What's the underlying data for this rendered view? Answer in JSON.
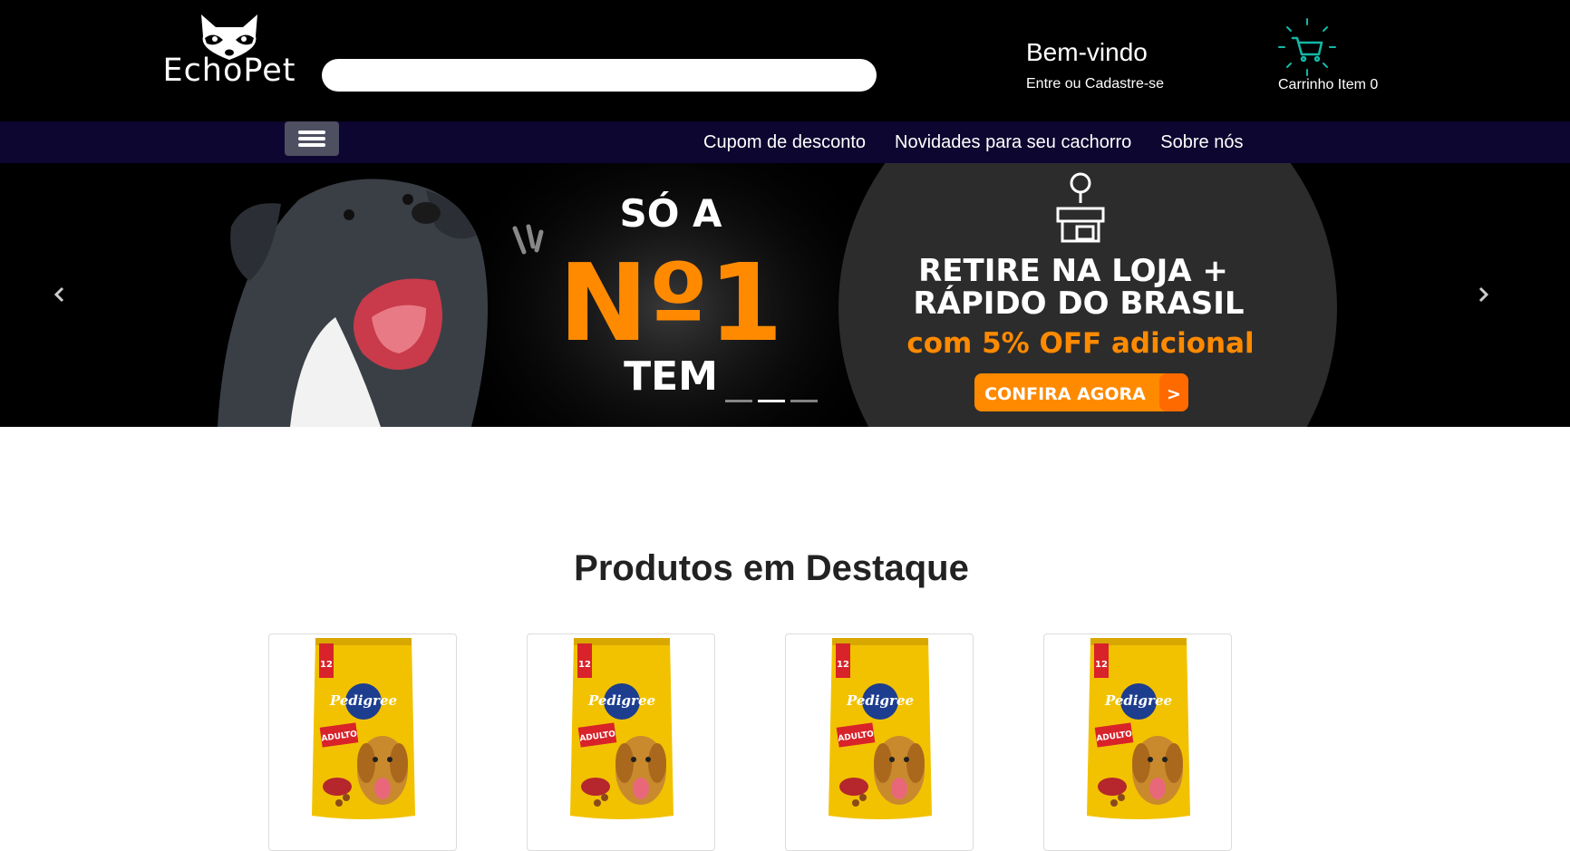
{
  "header": {
    "logo_text": "EchoPet",
    "search": {
      "value": "",
      "placeholder": ""
    },
    "welcome_title": "Bem-vindo",
    "login_link": "Entre ou Cadastre-se",
    "cart_label": "Carrinho Item 0"
  },
  "nav": {
    "menu_icon": "hamburger-icon",
    "links": [
      "Cupom de desconto",
      "Novidades para seu cachorro",
      "Sobre nós"
    ]
  },
  "carousel": {
    "slide_text": {
      "line1": "SÓ A",
      "line2": "Nº1",
      "line3": "TEM",
      "headline1": "RETIRE NA LOJA +",
      "headline2": "RÁPIDO DO BRASIL",
      "offer": "com 5% OFF adicional",
      "cta": "CONFIRA AGORA",
      "cta_arrow": ">"
    },
    "indicator_count": 3,
    "active_indicator": 2,
    "prev_icon": "chevron-left-icon",
    "next_icon": "chevron-right-icon",
    "store_icon": "store-location-icon"
  },
  "featured": {
    "title": "Produtos em Destaque",
    "products": [
      {
        "brand": "Pedigree",
        "badge": "12",
        "label": "ADULTO"
      },
      {
        "brand": "Pedigree",
        "badge": "12",
        "label": "ADULTO"
      },
      {
        "brand": "Pedigree",
        "badge": "12",
        "label": "ADULTO"
      },
      {
        "brand": "Pedigree",
        "badge": "12",
        "label": "ADULTO"
      }
    ]
  },
  "colors": {
    "header_bg": "#000000",
    "nav_bg": "#0c0630",
    "accent_orange": "#ff8a00",
    "cart_teal": "#14b8a6",
    "bag_yellow": "#f2c200",
    "title_text": "#222222"
  }
}
